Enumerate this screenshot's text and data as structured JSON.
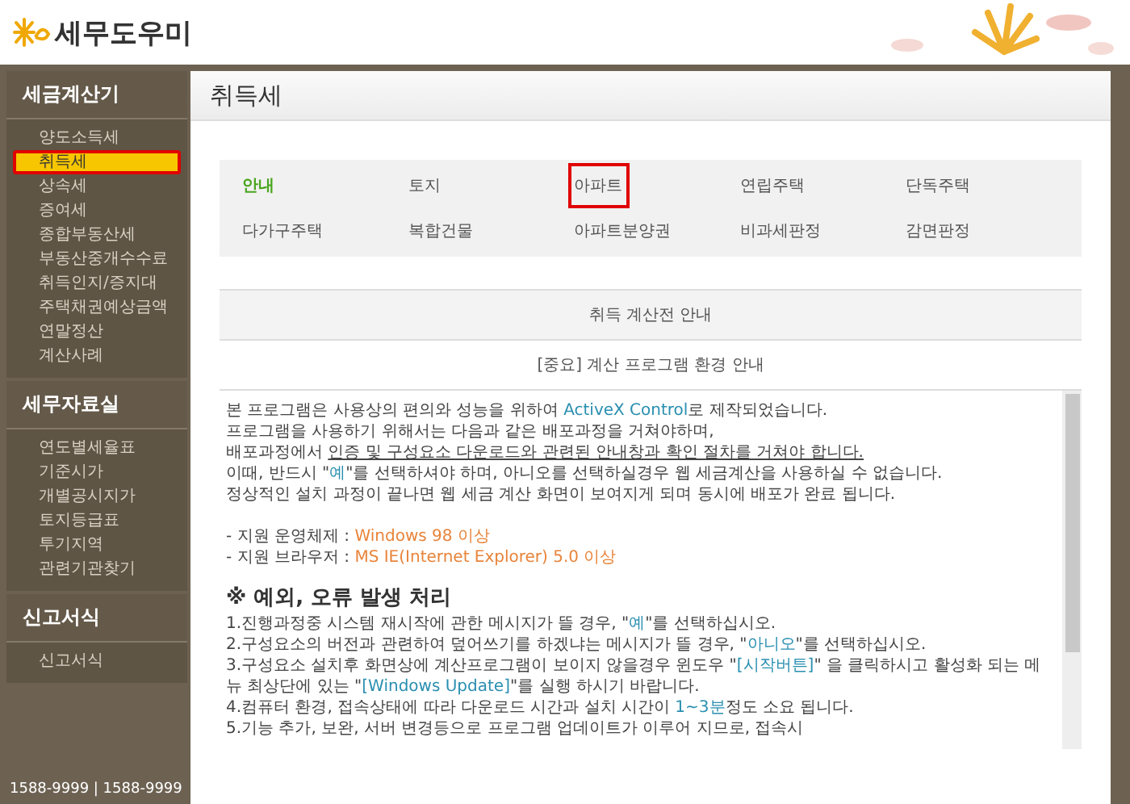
{
  "logo": {
    "text": "세무도우미"
  },
  "sidebar": {
    "sections": [
      {
        "title": "세금계산기",
        "items": [
          {
            "label": "양도소득세",
            "selected": false,
            "highlighted": false
          },
          {
            "label": "취득세",
            "selected": true,
            "highlighted": true
          },
          {
            "label": "상속세",
            "selected": false,
            "highlighted": false
          },
          {
            "label": "증여세",
            "selected": false,
            "highlighted": false
          },
          {
            "label": "종합부동산세",
            "selected": false,
            "highlighted": false
          },
          {
            "label": "부동산중개수수료",
            "selected": false,
            "highlighted": false
          },
          {
            "label": "취득인지/증지대",
            "selected": false,
            "highlighted": false
          },
          {
            "label": "주택채권예상금액",
            "selected": false,
            "highlighted": false
          },
          {
            "label": "연말정산",
            "selected": false,
            "highlighted": false
          },
          {
            "label": "계산사례",
            "selected": false,
            "highlighted": false
          }
        ]
      },
      {
        "title": "세무자료실",
        "items": [
          {
            "label": "연도별세율표",
            "selected": false,
            "highlighted": false
          },
          {
            "label": "기준시가",
            "selected": false,
            "highlighted": false
          },
          {
            "label": "개별공시지가",
            "selected": false,
            "highlighted": false
          },
          {
            "label": "토지등급표",
            "selected": false,
            "highlighted": false
          },
          {
            "label": "투기지역",
            "selected": false,
            "highlighted": false
          },
          {
            "label": "관련기관찾기",
            "selected": false,
            "highlighted": false
          }
        ]
      },
      {
        "title": "신고서식",
        "items": [
          {
            "label": "신고서식",
            "selected": false,
            "highlighted": false
          }
        ]
      }
    ],
    "footer": "1588-9999 | 1588-9999"
  },
  "page_title": "취득세",
  "tabs": [
    {
      "label": "안내",
      "selected": true,
      "highlighted": false
    },
    {
      "label": "토지",
      "selected": false,
      "highlighted": false
    },
    {
      "label": "아파트",
      "selected": false,
      "highlighted": true
    },
    {
      "label": "연립주택",
      "selected": false,
      "highlighted": false
    },
    {
      "label": "단독주택",
      "selected": false,
      "highlighted": false
    },
    {
      "label": "다가구주택",
      "selected": false,
      "highlighted": false
    },
    {
      "label": "복합건물",
      "selected": false,
      "highlighted": false
    },
    {
      "label": "아파트분양권",
      "selected": false,
      "highlighted": false
    },
    {
      "label": "비과세판정",
      "selected": false,
      "highlighted": false
    },
    {
      "label": "감면판정",
      "selected": false,
      "highlighted": false
    }
  ],
  "notice_rows": [
    "취득 계산전 안내",
    "[중요] 계산 프로그램 환경 안내"
  ],
  "body": [
    {
      "kind": "line",
      "parts": [
        {
          "kind": "plain",
          "text": "본 프로그램은 사용상의 편의와 성능을 위하여 "
        },
        {
          "kind": "link",
          "text": "ActiveX Control"
        },
        {
          "kind": "plain",
          "text": "로 제작되었습니다."
        }
      ]
    },
    {
      "kind": "line",
      "parts": [
        {
          "kind": "plain",
          "text": "프로그램을 사용하기 위해서는 다음과 같은 배포과정을 거쳐야하며,"
        }
      ]
    },
    {
      "kind": "line",
      "parts": [
        {
          "kind": "plain",
          "text": "배포과정에서 "
        },
        {
          "kind": "underline",
          "text": "인증 및 구성요소 다운로드와 관련된 안내창과 확인 절차를 거쳐야 합니다."
        }
      ]
    },
    {
      "kind": "line",
      "parts": [
        {
          "kind": "plain",
          "text": "이때, 반드시 \""
        },
        {
          "kind": "link",
          "text": "예"
        },
        {
          "kind": "plain",
          "text": "\"를 선택하셔야 하며, 아니오를 선택하실경우 웹 세금계산을 사용하실 수 없습니다."
        }
      ]
    },
    {
      "kind": "line",
      "parts": [
        {
          "kind": "plain",
          "text": "정상적인 설치 과정이 끝나면 웹 세금 계산 화면이 보여지게 되며 동시에 배포가 완료 됩니다."
        }
      ]
    },
    {
      "kind": "gap"
    },
    {
      "kind": "line",
      "parts": [
        {
          "kind": "plain",
          "text": "- 지원 운영체제 : "
        },
        {
          "kind": "accent",
          "text": "Windows 98 이상"
        }
      ]
    },
    {
      "kind": "line",
      "parts": [
        {
          "kind": "plain",
          "text": "- 지원 브라우저 : "
        },
        {
          "kind": "accent",
          "text": "MS IE(Internet Explorer) 5.0 이상"
        }
      ]
    },
    {
      "kind": "heading",
      "parts": [
        {
          "kind": "plain",
          "text": "※ 예외, 오류 발생 처리"
        }
      ]
    },
    {
      "kind": "line",
      "parts": [
        {
          "kind": "plain",
          "text": "1.진행과정중 시스템 재시작에 관한 메시지가 뜰 경우, \""
        },
        {
          "kind": "link",
          "text": "예"
        },
        {
          "kind": "plain",
          "text": "\"를 선택하십시오."
        }
      ]
    },
    {
      "kind": "line",
      "parts": [
        {
          "kind": "plain",
          "text": "2.구성요소의 버전과 관련하여 덮어쓰기를 하겠냐는 메시지가 뜰 경우, \""
        },
        {
          "kind": "link",
          "text": "아니오"
        },
        {
          "kind": "plain",
          "text": "\"를 선택하십시오."
        }
      ]
    },
    {
      "kind": "line",
      "parts": [
        {
          "kind": "plain",
          "text": "3.구성요소 설치후 화면상에 계산프로그램이 보이지 않을경우 윈도우 \""
        },
        {
          "kind": "link",
          "text": "[시작버튼]"
        },
        {
          "kind": "plain",
          "text": "\" 을 클릭하시고 활성화 되는 메뉴 최상단에 있는 \""
        },
        {
          "kind": "link",
          "text": "[Windows Update]"
        },
        {
          "kind": "plain",
          "text": "\"를 실행 하시기 바랍니다."
        }
      ]
    },
    {
      "kind": "line",
      "parts": [
        {
          "kind": "plain",
          "text": "4.컴퓨터 환경, 접속상태에 따라 다운로드 시간과 설치 시간이 "
        },
        {
          "kind": "link",
          "text": "1~3분"
        },
        {
          "kind": "plain",
          "text": "정도 소요 됩니다."
        }
      ]
    },
    {
      "kind": "line",
      "parts": [
        {
          "kind": "plain",
          "text": "5.기능 추가, 보완, 서버 변경등으로 프로그램 업데이트가 이루어 지므로, 접속시"
        }
      ]
    }
  ]
}
